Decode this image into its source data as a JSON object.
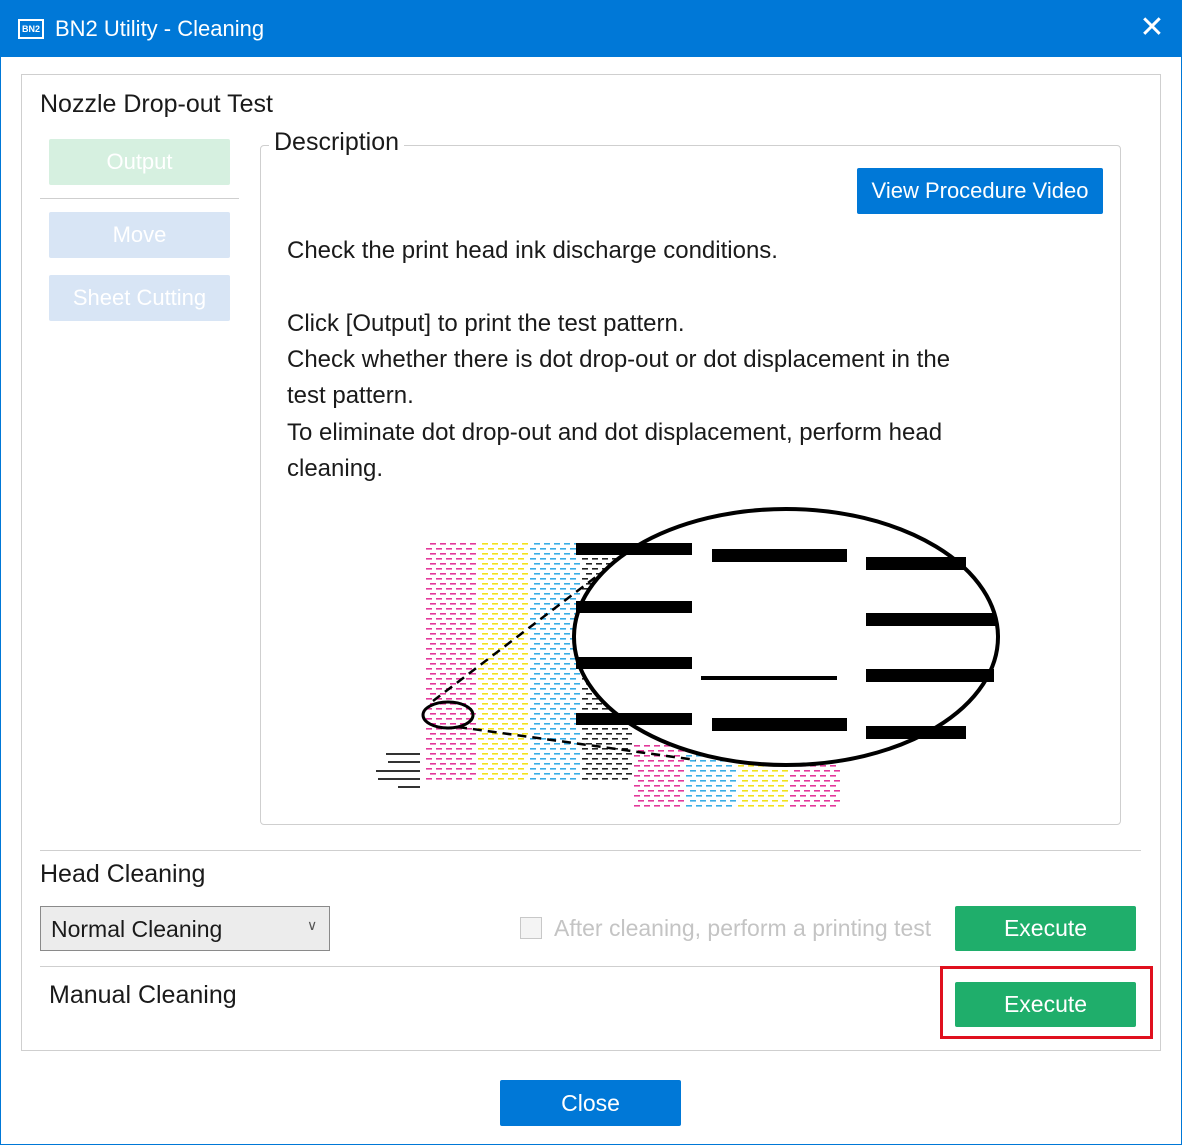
{
  "window": {
    "title": "BN2 Utility - Cleaning",
    "app_icon_text": "BN2",
    "close_glyph": "✕"
  },
  "nozzle_test": {
    "title": "Nozzle Drop-out Test",
    "output_label": "Output",
    "move_label": "Move",
    "sheet_cutting_label": "Sheet Cutting"
  },
  "description": {
    "legend": "Description",
    "video_button": "View Procedure Video",
    "lines": [
      "Check the print head ink discharge conditions.",
      "Click [Output] to print the test pattern.",
      "Check whether there is dot drop-out or dot displacement in the",
      "test pattern.",
      "To eliminate dot drop-out and dot displacement, perform head",
      "cleaning."
    ],
    "illustration_colors": {
      "magenta": "#e2389a",
      "yellow": "#f2e21c",
      "cyan": "#39aee6",
      "black": "#222222"
    }
  },
  "head_cleaning": {
    "title": "Head Cleaning",
    "mode_value": "Normal Cleaning",
    "after_cleaning_label": "After cleaning, perform a printing test",
    "after_cleaning_checked": false,
    "execute_label": "Execute"
  },
  "manual_cleaning": {
    "title": "Manual Cleaning",
    "execute_label": "Execute"
  },
  "footer": {
    "close_label": "Close"
  },
  "colors": {
    "accent_blue": "#0078d7",
    "execute_green": "#1fae6b",
    "highlight_red": "#e0101e"
  }
}
